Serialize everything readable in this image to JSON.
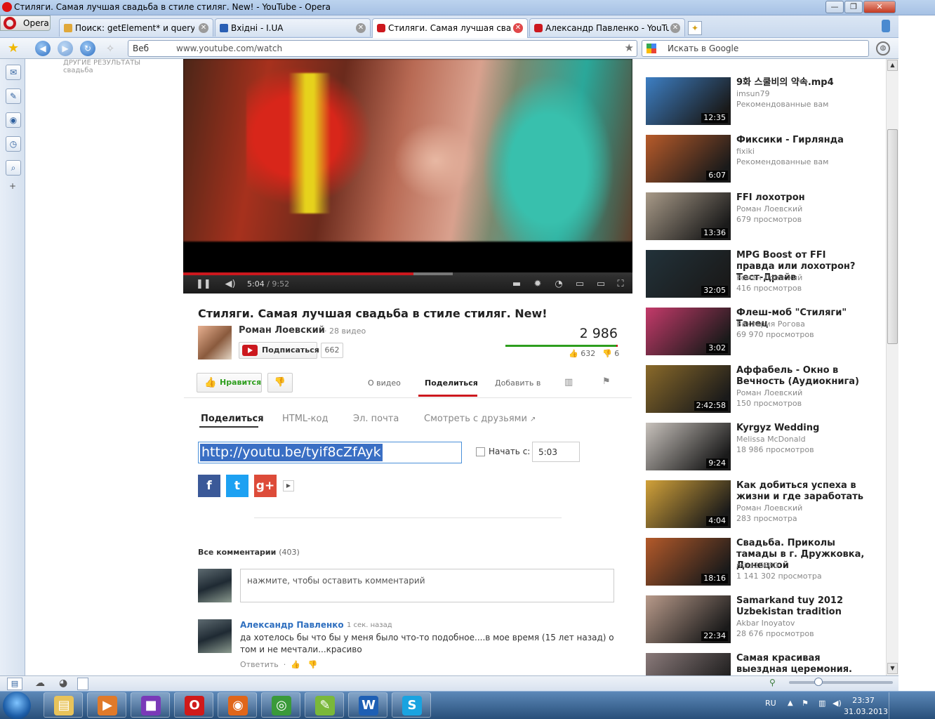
{
  "window": {
    "title": "Стиляги. Самая лучшая свадьба в стиле стиляг. New! - YouTube - Opera",
    "controls": [
      "—",
      "❐",
      "✕"
    ]
  },
  "browser": {
    "menu_label": "Opera",
    "tabs": [
      {
        "label": "Поиск: getElement* и querySele...",
        "active": false
      },
      {
        "label": "Вхідні - I.UA",
        "active": false
      },
      {
        "label": "Стиляги. Самая лучшая свадь...",
        "active": true
      },
      {
        "label": "Александр Павленко - YouTube",
        "active": false
      }
    ],
    "address": {
      "prefix": "Веб",
      "url": "www.youtube.com/watch"
    },
    "search_placeholder": "Искать в Google"
  },
  "page": {
    "other_results": {
      "label": "ДРУГИЕ РЕЗУЛЬТАТЫ",
      "query": "свадьба"
    },
    "player": {
      "current": "5:04",
      "duration": "/ 9:52",
      "played_fraction": 0.512,
      "buffered_fraction": 0.6
    },
    "video": {
      "title": "Стиляги. Самая лучшая свадьба в стиле стиляг. New!",
      "channel": "Роман Лоевский",
      "channel_videos": "· 28 видео",
      "subscribe_label": "Подписаться",
      "subscriber_count": "662",
      "views": "2 986",
      "likes": "632",
      "dislikes": "6",
      "like_fraction": 0.99
    },
    "actions": {
      "like_label": "Нравится"
    },
    "panel_tabs": [
      "О видео",
      "Поделиться",
      "Добавить в"
    ],
    "share": {
      "tabs": [
        "Поделиться",
        "HTML-код",
        "Эл. почта",
        "Смотреть с друзьями"
      ],
      "url": "http://youtu.be/tyif8cZfAyk",
      "start_label": "Начать с:",
      "start_time": "5:03",
      "social": [
        "f",
        "t",
        "g+"
      ]
    },
    "comments": {
      "header": "Все комментарии",
      "count": "(403)",
      "placeholder": "нажмите, чтобы оставить комментарий",
      "items": [
        {
          "author": "Александр Павленко",
          "time": "1 сек. назад",
          "text": "да хотелось бы что бы у меня было что-то подобное....в мое время (15 лет назад) о том  и не мечтали...красиво",
          "reply": "Ответить"
        }
      ]
    },
    "recommendations": [
      {
        "title": "9화 스쿨비의 약속.mp4",
        "author": "imsun79",
        "meta": "Рекомендованные вам",
        "duration": "12:35",
        "color": "#3d7fc4"
      },
      {
        "title": "Фиксики - Гирлянда",
        "author": "fixiki",
        "meta": "Рекомендованные вам",
        "duration": "6:07",
        "color": "#b85b2a"
      },
      {
        "title": "FFI лохотрон",
        "author": "Роман Лоевский",
        "meta": "679 просмотров",
        "duration": "13:36",
        "color": "#a89a88"
      },
      {
        "title": "MPG Boost от FFI правда или лохотрон? Тест-Драйв",
        "author": "Роман Лоевский",
        "meta": "416 просмотров",
        "duration": "32:05",
        "color": "#22323a"
      },
      {
        "title": "Флеш-моб \"Стиляги\" Танец",
        "author": "Виктория Рогова",
        "meta": "69 970 просмотров",
        "duration": "3:02",
        "color": "#c43a6a"
      },
      {
        "title": "Аффабель - Окно в Вечность (Аудиокнига)",
        "author": "Роман Лоевский",
        "meta": "150 просмотров",
        "duration": "2:42:58",
        "color": "#8a6a2a"
      },
      {
        "title": "Kyrgyz Wedding",
        "author": "Melissa McDonald",
        "meta": "18 986 просмотров",
        "duration": "9:24",
        "color": "#c8c2bc"
      },
      {
        "title": "Как добиться успеха в жизни и где заработать",
        "author": "Роман Лоевский",
        "meta": "283 просмотра",
        "duration": "4:04",
        "color": "#d2a23a"
      },
      {
        "title": "Свадьба. Приколы тамады в г. Дружковка, Донецкой",
        "author": "mira26680",
        "meta": "1 141 302 просмотра",
        "duration": "18:16",
        "color": "#b45a2a"
      },
      {
        "title": "Samarkand tuy 2012 Uzbekistan tradition",
        "author": "Akbar Inoyatov",
        "meta": "28 676 просмотров",
        "duration": "22:34",
        "color": "#b89a8a"
      },
      {
        "title": "Самая красивая выездная церемония. Свадьба в",
        "author": "",
        "meta": "",
        "duration": "",
        "color": "#8a7a7a"
      }
    ]
  },
  "taskbar": {
    "lang": "RU",
    "time": "23:37",
    "date": "31.03.2013",
    "apps": [
      {
        "name": "explorer",
        "glyph": "▤",
        "color": "#e8c35a"
      },
      {
        "name": "media",
        "glyph": "▶",
        "color": "#e07a2a"
      },
      {
        "name": "save",
        "glyph": "■",
        "color": "#7a3ab8"
      },
      {
        "name": "opera",
        "glyph": "O",
        "color": "#d01a1a"
      },
      {
        "name": "firefox",
        "glyph": "◉",
        "color": "#e0661a"
      },
      {
        "name": "chrome",
        "glyph": "◎",
        "color": "#3a9a3a"
      },
      {
        "name": "notepad",
        "glyph": "✎",
        "color": "#7ab83a"
      },
      {
        "name": "word",
        "glyph": "W",
        "color": "#1e5fb4"
      },
      {
        "name": "skype",
        "glyph": "S",
        "color": "#1aa3e0"
      }
    ]
  }
}
